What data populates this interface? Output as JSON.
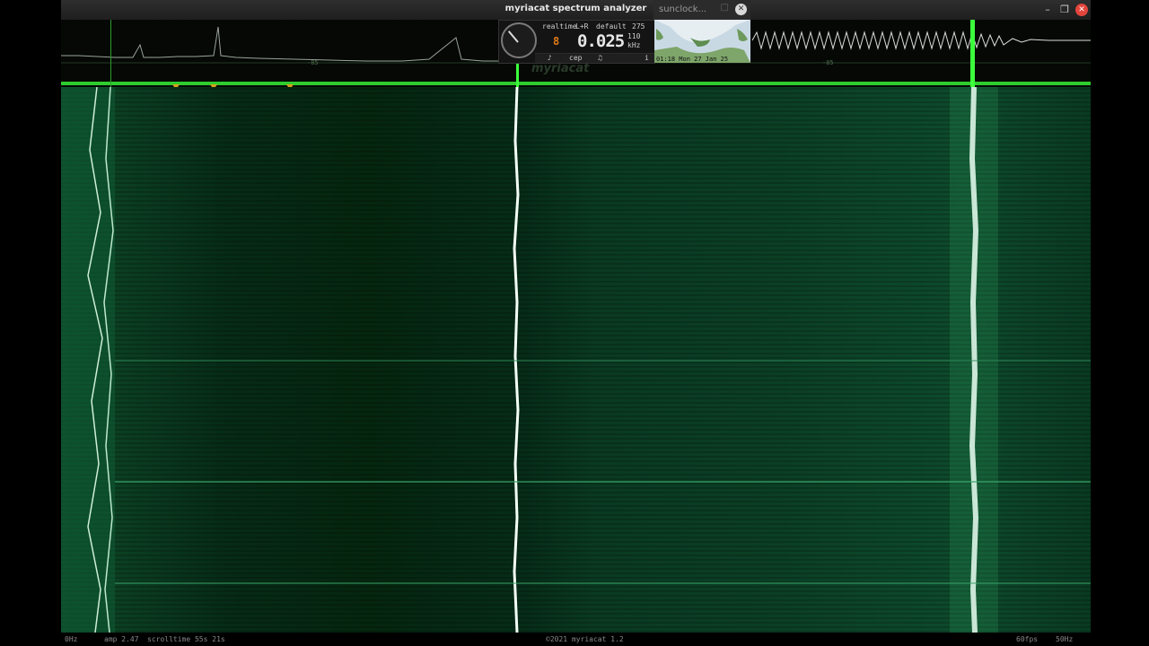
{
  "window": {
    "title": "myriacat spectrum analyzer"
  },
  "sunclock": {
    "tab_title": "sunclock...",
    "time_caption": "01:18 Mon 27 Jan 25"
  },
  "hud": {
    "mode": "realtime",
    "channel": "L+R",
    "preset": "default",
    "number": "275",
    "value": "0.025",
    "value_prefix": "8",
    "unit_top": "110",
    "unit_bottom": "kHz",
    "button_cep": "cep",
    "button_info": "i",
    "watermark": "myriacat"
  },
  "spectrum": {
    "db_label_left": "-85",
    "db_label_right": "-85"
  },
  "footer": {
    "freq_start": "0Hz",
    "amp": "amp 2.47",
    "scrolltime": "scrolltime 55s 21s",
    "copyright": "©2021 myriacat 1.2",
    "fps": "60fps",
    "freq_end": "50Hz"
  },
  "colors": {
    "accent_green": "#3cff3c",
    "waterfall_dark": "#062b16",
    "trace_white": "#f4fff6"
  }
}
